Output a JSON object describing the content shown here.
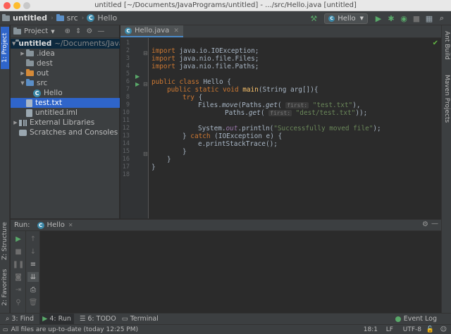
{
  "window": {
    "title": "untitled [~/Documents/JavaPrograms/untitled] - .../src/Hello.java [untitled]"
  },
  "breadcrumb": [
    "untitled",
    "src",
    "Hello"
  ],
  "toolbar": {
    "run_config": "Hello"
  },
  "left_stripe": {
    "project_tab": "1: Project",
    "structure_tab": "Z: Structure",
    "favorites_tab": "2: Favorites"
  },
  "right_stripe": {
    "ant_tab": "Ant Build",
    "maven_tab": "Maven Projects"
  },
  "project_panel": {
    "title": "Project",
    "root": {
      "name": "untitled",
      "path": "~/Documents/JavaP"
    },
    "items": [
      {
        "label": ".idea"
      },
      {
        "label": "dest"
      },
      {
        "label": "out"
      },
      {
        "label": "src"
      },
      {
        "label": "Hello"
      },
      {
        "label": "test.txt"
      },
      {
        "label": "untitled.iml"
      },
      {
        "label": "External Libraries"
      },
      {
        "label": "Scratches and Consoles"
      }
    ]
  },
  "editor": {
    "tab": "Hello.java",
    "line_numbers": [
      "1",
      "2",
      "3",
      "4",
      "5",
      "6",
      "7",
      "8",
      "9",
      "10",
      "11",
      "12",
      "13",
      "14",
      "15",
      "16",
      "17",
      "18"
    ],
    "code": {
      "l2_kw": "import ",
      "l2_rest": "java.io.IOException;",
      "l3_kw": "import ",
      "l3_rest": "java.nio.file.Files;",
      "l4_kw": "import ",
      "l4_rest": "java.nio.file.Paths;",
      "l6_kw": "public class ",
      "l6_rest": "Hello {",
      "l7_kw": "public static void ",
      "l7_fn": "main",
      "l7_rest": "(String arg[]){",
      "l8_kw": "try ",
      "l8_rest": "{",
      "l9_a": "Files.",
      "l9_m": "move",
      "l9_b": "(Paths.",
      "l9_m2": "get",
      "l9_c": "( ",
      "l9_hint": "first:",
      "l9_str": " \"test.txt\"",
      "l9_d": "),",
      "l10_a": "Paths.",
      "l10_m": "get",
      "l10_c": "( ",
      "l10_hint": "first:",
      "l10_str": " \"dest/test.txt\"",
      "l10_d": "));",
      "l12_a": "System.",
      "l12_out": "out",
      "l12_b": ".println(",
      "l12_str": "\"Successfully moved file\"",
      "l12_c": ");",
      "l13_a": "} ",
      "l13_kw": "catch ",
      "l13_b": "(IOException e) {",
      "l14": "e.printStackTrace();",
      "l15": "}",
      "l16": "}",
      "l17": "}"
    }
  },
  "run_panel": {
    "label": "Run:",
    "tab": "Hello"
  },
  "bottom_tabs": {
    "find": "3: Find",
    "run": "4: Run",
    "todo": "6: TODO",
    "terminal": "Terminal",
    "event_log": "Event Log"
  },
  "status": {
    "message": "All files are up-to-date (today 12:25 PM)",
    "position": "18:1",
    "line_sep": "LF",
    "encoding": "UTF-8"
  },
  "colors": {
    "accent": "#2f65ca",
    "run_green": "#59a869",
    "keyword": "#cc7832",
    "string": "#6a8759"
  }
}
